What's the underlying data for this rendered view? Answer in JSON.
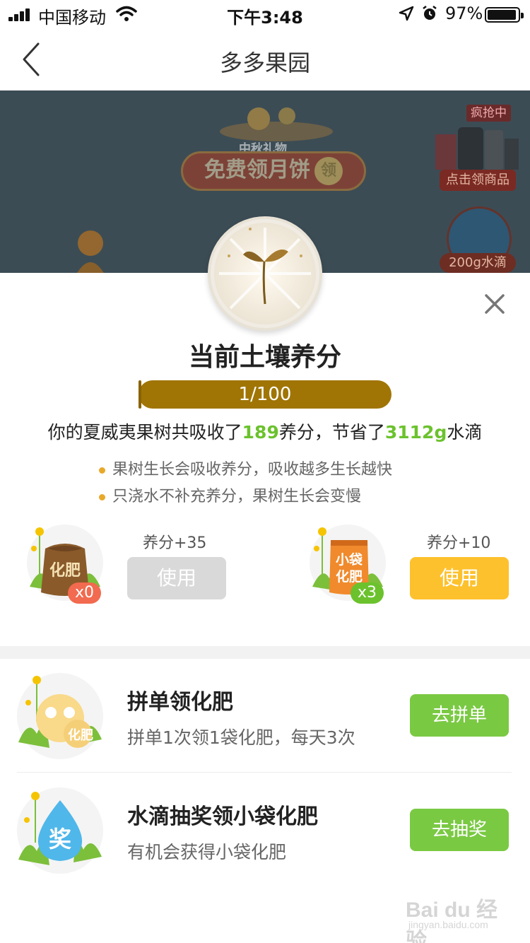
{
  "status_bar": {
    "carrier": "中国移动",
    "time": "下午3:48",
    "battery": "97%"
  },
  "nav": {
    "title": "多多果园"
  },
  "background": {
    "promo_sub": "中秋礼物",
    "promo_main": "免费领月饼",
    "promo_badge": "领",
    "rush_tag": "疯抢中",
    "goods_label": "点击领商品",
    "water_label": "200g水滴"
  },
  "modal": {
    "title": "当前土壤养分",
    "progress": {
      "text": "1/100",
      "value": 1,
      "max": 100
    },
    "summary": {
      "prefix": "你的夏威夷果树共吸收了",
      "nutrient_value": "189",
      "middle": "养分，节省了",
      "water_value": "3112g",
      "suffix": "水滴"
    },
    "tips": [
      "果树生长会吸收养分，吸收越多生长越快",
      "只浇水不补充养分，果树生长会变慢"
    ],
    "fertilizers": [
      {
        "icon_text": "化肥",
        "count": "x0",
        "bonus": "养分+35",
        "button": "使用",
        "enabled": false
      },
      {
        "icon_text_1": "小袋",
        "icon_text_2": "化肥",
        "count": "x3",
        "bonus": "养分+10",
        "button": "使用",
        "enabled": true
      }
    ],
    "tasks": [
      {
        "title": "拼单领化肥",
        "desc": "拼单1次领1袋化肥，每天3次",
        "button": "去拼单",
        "icon_text": "化肥"
      },
      {
        "title": "水滴抽奖领小袋化肥",
        "desc": "有机会获得小袋化肥",
        "button": "去抽奖",
        "icon_text": "奖"
      }
    ]
  },
  "watermark": {
    "text": "Bai du 经验",
    "sub": "jingyan.baidu.com"
  },
  "colors": {
    "accent_green": "#6bc22d",
    "button_green": "#7ac943",
    "button_yellow": "#fdc12d",
    "progress_gold": "#a07505",
    "disabled_gray": "#d9d9d9"
  },
  "icons": [
    "signal-icon",
    "wifi-icon",
    "location-arrow-icon",
    "alarm-icon",
    "battery-icon",
    "back-chevron-icon",
    "close-icon",
    "sprout-icon",
    "fertilizer-bag-icon",
    "small-fertilizer-bag-icon",
    "fertilizer-task-icon",
    "water-drop-lottery-icon"
  ]
}
